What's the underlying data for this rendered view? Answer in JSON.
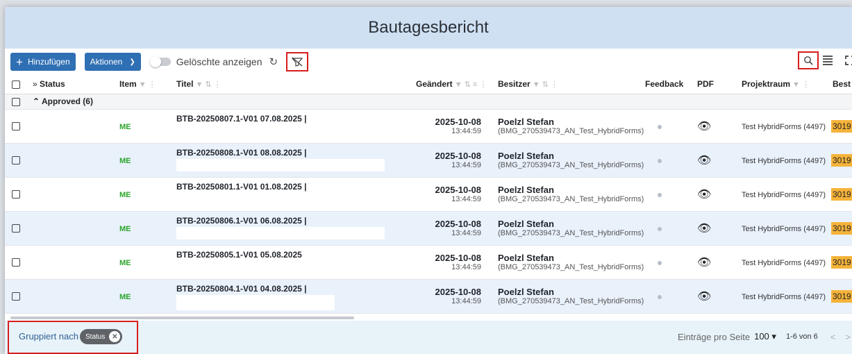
{
  "title": "Bautagesbericht",
  "toolbar": {
    "add_label": "Hinzufügen",
    "actions_label": "Aktionen",
    "toggle_label": "Gelöschte anzeigen",
    "refresh_glyph": "C",
    "icons": [
      "plus-icon",
      "chevron-down-icon",
      "refresh-icon",
      "filter-off-icon",
      "search-icon",
      "columns-icon",
      "fullscreen-icon"
    ]
  },
  "columns": {
    "status": "Status",
    "item": "Item",
    "titel": "Titel",
    "geaendert": "Geändert",
    "besitzer": "Besitzer",
    "feedback": "Feedback",
    "pdf": "PDF",
    "projektraum": "Projektraum",
    "extra": "Best"
  },
  "group": {
    "label": "Approved (6)"
  },
  "rows": [
    {
      "item": "ME",
      "title": "BTB-20250807.1-V01 07.08.2025 |",
      "date": "2025-10-08",
      "time": "13:44:59",
      "owner": "Poelzl Stefan",
      "owner_sub": "(BMG_270539473_AN_Test_HybridForms)",
      "project": "Test HybridForms (4497)",
      "tag": "3019"
    },
    {
      "item": "ME",
      "title": "BTB-20250808.1-V01 08.08.2025 |",
      "date": "2025-10-08",
      "time": "13:44:59",
      "owner": "Poelzl Stefan",
      "owner_sub": "(BMG_270539473_AN_Test_HybridForms)",
      "project": "Test HybridForms (4497)",
      "tag": "3019"
    },
    {
      "item": "ME",
      "title": "BTB-20250801.1-V01 01.08.2025 |",
      "date": "2025-10-08",
      "time": "13:44:59",
      "owner": "Poelzl Stefan",
      "owner_sub": "(BMG_270539473_AN_Test_HybridForms)",
      "project": "Test HybridForms (4497)",
      "tag": "3019"
    },
    {
      "item": "ME",
      "title": "BTB-20250806.1-V01 06.08.2025 |",
      "date": "2025-10-08",
      "time": "13:44:59",
      "owner": "Poelzl Stefan",
      "owner_sub": "(BMG_270539473_AN_Test_HybridForms)",
      "project": "Test HybridForms (4497)",
      "tag": "3019"
    },
    {
      "item": "ME",
      "title": "BTB-20250805.1-V01 05.08.2025",
      "date": "2025-10-08",
      "time": "13:44:59",
      "owner": "Poelzl Stefan",
      "owner_sub": "(BMG_270539473_AN_Test_HybridForms)",
      "project": "Test HybridForms (4497)",
      "tag": "3019"
    },
    {
      "item": "ME",
      "title": "BTB-20250804.1-V01 04.08.2025 |",
      "date": "2025-10-08",
      "time": "13:44:59",
      "owner": "Poelzl Stefan",
      "owner_sub": "(BMG_270539473_AN_Test_HybridForms)",
      "project": "Test HybridForms (4497)",
      "tag": "3019"
    }
  ],
  "footer": {
    "grouped_by": "Gruppiert nach",
    "chip": "Status",
    "per_page_label": "Einträge pro Seite",
    "per_page_value": "100",
    "count": "1-6 von 6"
  },
  "colors": {
    "accent": "#2f6fb3",
    "header_bg": "#cfe0f3",
    "highlight_red": "#d71d1d",
    "item_green": "#2aa52a",
    "tag_orange": "#f5b33a"
  }
}
